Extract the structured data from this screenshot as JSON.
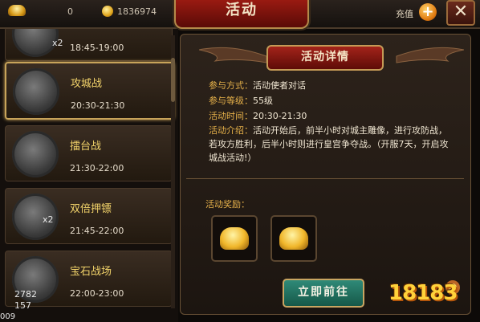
{
  "header": {
    "ingot_count": "0",
    "coin_count": "1836974",
    "title": "活动",
    "recharge_label": "充值",
    "plus_symbol": "+",
    "close_symbol": "✕"
  },
  "activities": [
    {
      "name": "",
      "time": "18:45-19:00",
      "badge": "x2"
    },
    {
      "name": "攻城战",
      "time": "20:30-21:30",
      "badge": ""
    },
    {
      "name": "擂台战",
      "time": "21:30-22:00",
      "badge": ""
    },
    {
      "name": "双倍押镖",
      "time": "21:45-22:00",
      "badge": "x2"
    },
    {
      "name": "宝石战场",
      "time": "22:00-23:00",
      "badge": ""
    }
  ],
  "status": {
    "ping_top": "2782",
    "ping_bottom": "157",
    "bottom_left": "009"
  },
  "detail": {
    "title": "活动详情",
    "rows": [
      {
        "key": "参与方式：",
        "value": "活动使者对话"
      },
      {
        "key": "参与等级：",
        "value": "55级"
      },
      {
        "key": "活动时间：",
        "value": "20:30-21:30"
      }
    ],
    "desc_key": "活动介绍：",
    "desc_value": "活动开始后，前半小时对城主雕像，进行攻防战，若攻方胜利，后半小时则进行皇宫争夺战。（开服7天，开启攻城战活动!）",
    "reward_label": "活动奖励：",
    "go_button": "立即前往"
  },
  "watermark": {
    "text": "18183"
  },
  "colors": {
    "accent_gold": "#e6b14a",
    "title_red": "#9d1b12",
    "button_teal": "#2f8a78"
  }
}
